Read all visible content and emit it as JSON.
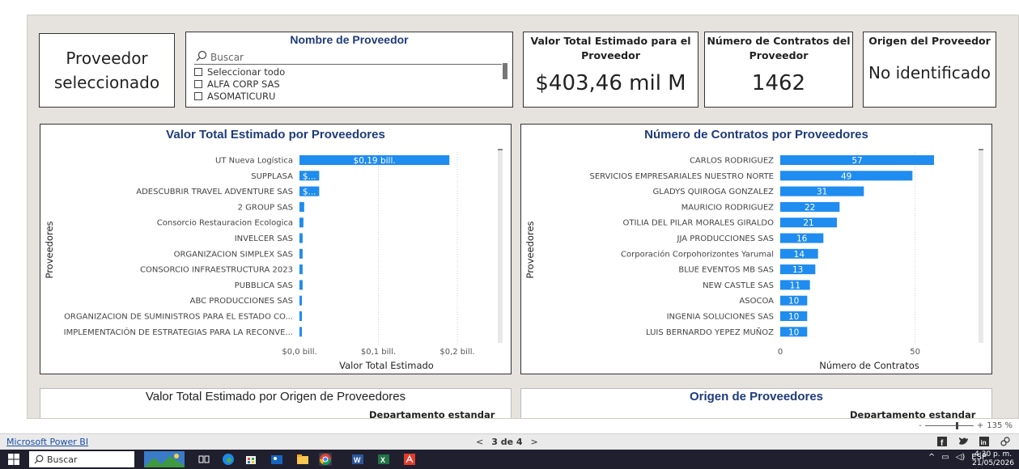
{
  "window": {
    "app_link": "Microsoft Power BI"
  },
  "pager": {
    "prev": "<",
    "label": "3 de 4",
    "next": ">"
  },
  "zoom": {
    "minus": "-",
    "plus": "+",
    "level": "135 %"
  },
  "selected_card": {
    "line1": "Proveedor",
    "line2": "seleccionado"
  },
  "slicer": {
    "title": "Nombre de Proveedor",
    "search_placeholder": "Buscar",
    "options": [
      "Seleccionar todo",
      "ALFA CORP SAS",
      "ASOMATICURU"
    ]
  },
  "kpis": {
    "valor_title": "Valor Total Estimado para el Proveedor",
    "valor_value": "$403,46 mil M",
    "num_title": "Número de Contratos del Proveedor",
    "num_value": "1462",
    "origen_title": "Origen del Proveedor",
    "origen_value": "No identificado"
  },
  "chart_data": [
    {
      "type": "bar",
      "orientation": "horizontal",
      "title": "Valor Total Estimado por Proveedores",
      "xlabel": "Valor Total Estimado",
      "ylabel": "Proveedores",
      "xlim": [
        0,
        0.2
      ],
      "xticks": [
        0,
        0.1,
        0.2
      ],
      "xtick_labels": [
        "$0,0 bill.",
        "$0,1 bill.",
        "$0,2 bill."
      ],
      "categories": [
        "UT Nueva Logística",
        "SUPPLASA",
        "ADESCUBRIR TRAVEL ADVENTURE SAS",
        "2 GROUP SAS",
        "Consorcio Restauracion Ecologica",
        "INVELCER SAS",
        "ORGANIZACION SIMPLEX SAS",
        "CONSORCIO INFRAESTRUCTURA 2023",
        "PUBBLICA SAS",
        "ABC PRODUCCIONES SAS",
        "ORGANIZACION DE SUMINISTROS PARA EL ESTADO CO...",
        "IMPLEMENTACIÓN DE ESTRATEGIAS PARA LA RECONVE..."
      ],
      "values": [
        0.19,
        0.025,
        0.025,
        0.006,
        0.005,
        0.004,
        0.004,
        0.004,
        0.004,
        0.003,
        0.003,
        0.003
      ],
      "data_labels": [
        "$0,19 bill.",
        "$...",
        "$...",
        "",
        "",
        "",
        "",
        "",
        "",
        "",
        "",
        ""
      ],
      "grid": true,
      "color": "#1f8cf0"
    },
    {
      "type": "bar",
      "orientation": "horizontal",
      "title": "Número de Contratos por Proveedores",
      "xlabel": "Número de Contratos",
      "ylabel": "Proveedores",
      "xlim": [
        0,
        60
      ],
      "xticks": [
        0,
        50
      ],
      "xtick_labels": [
        "0",
        "50"
      ],
      "categories": [
        "CARLOS RODRIGUEZ",
        "SERVICIOS EMPRESARIALES NUESTRO NORTE",
        "GLADYS QUIROGA GONZALEZ",
        "MAURICIO RODRIGUEZ",
        "OTILIA DEL PILAR MORALES GIRALDO",
        "JJA PRODUCCIONES SAS",
        "Corporación Corpohorizontes Yarumal",
        "BLUE EVENTOS MB SAS",
        "NEW CASTLE SAS",
        "ASOCOA",
        "INGENIA SOLUCIONES SAS",
        "LUIS BERNARDO YEPEZ MUÑOZ"
      ],
      "values": [
        57,
        49,
        31,
        22,
        21,
        16,
        14,
        13,
        11,
        10,
        10,
        10
      ],
      "data_labels": [
        "57",
        "49",
        "31",
        "22",
        "21",
        "16",
        "14",
        "13",
        "11",
        "10",
        "10",
        "10"
      ],
      "grid": true,
      "color": "#1f8cf0"
    }
  ],
  "bottom": {
    "left_title": "Valor Total Estimado por Origen de Proveedores",
    "left_sub": "Departamento estandar",
    "right_title": "Origen de Proveedores",
    "right_sub": "Departamento estandar"
  },
  "taskbar": {
    "search": "Buscar",
    "lang": "ESP",
    "time": "4:30 p. m.",
    "date": "21/05/2026"
  }
}
